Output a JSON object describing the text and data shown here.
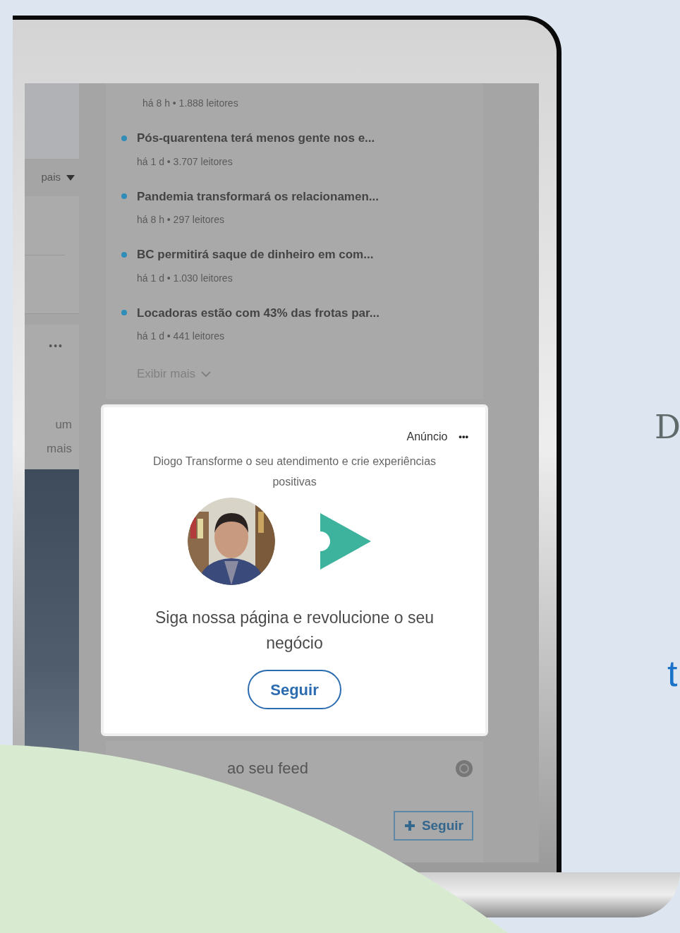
{
  "left_column": {
    "dropdown_label": "pais",
    "more": "•••",
    "text_lines": [
      "um",
      "mais"
    ]
  },
  "news": {
    "first_meta": "há 8 h • 1.888 leitores",
    "items": [
      {
        "headline": "Pós-quarentena terá menos gente nos e...",
        "meta": "há 1 d • 3.707 leitores"
      },
      {
        "headline": "Pandemia transformará os relacionamen...",
        "meta": "há 8 h • 297 leitores"
      },
      {
        "headline": "BC permitirá saque de dinheiro em com...",
        "meta": "há 1 d • 1.030 leitores"
      },
      {
        "headline": "Locadoras estão com 43% das frotas par...",
        "meta": "há 1 d • 441 leitores"
      }
    ],
    "show_more": "Exibir mais"
  },
  "ad": {
    "label": "Anúncio",
    "more": "•••",
    "headline": "Diogo Transforme o seu atendimento e crie experiências positivas",
    "message": "Siga nossa página e revolucione o seu negócio",
    "button": "Seguir"
  },
  "follow_section": {
    "title": "ao seu feed",
    "button": "Seguir"
  },
  "side_text": [
    {
      "text": "D",
      "kind": "serif"
    },
    {
      "text": "t",
      "kind": "accent"
    }
  ]
}
